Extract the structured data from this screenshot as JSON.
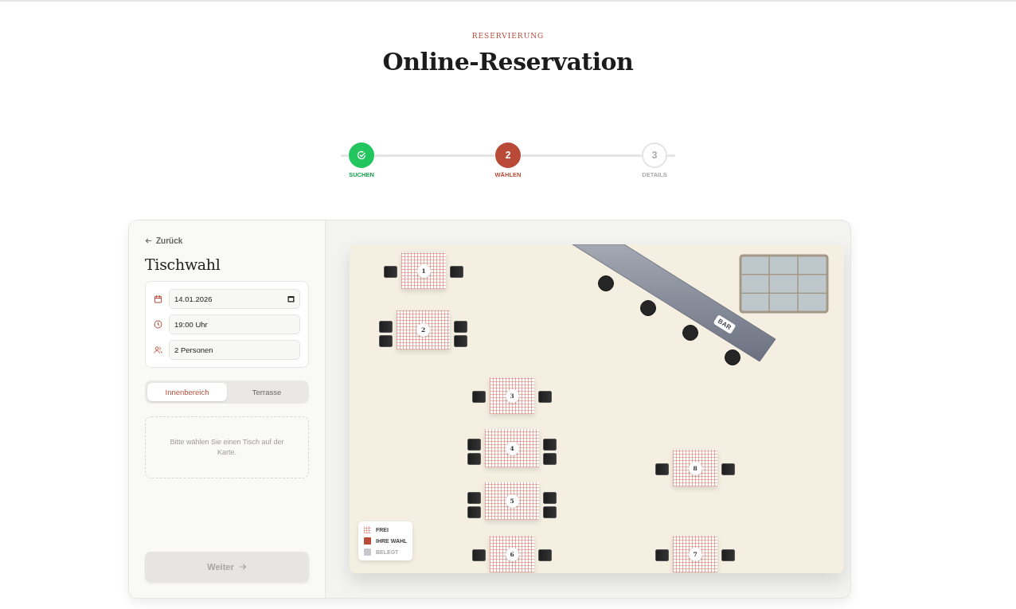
{
  "header": {
    "eyebrow": "RESERVIERUNG",
    "title": "Online-Reservation"
  },
  "steps": [
    {
      "label": "SUCHEN",
      "completed": true,
      "selected": false
    },
    {
      "label": "WÄHLEN",
      "number": "2",
      "completed": false,
      "selected": true
    },
    {
      "label": "DETAILS",
      "number": "3",
      "completed": false,
      "selected": false
    }
  ],
  "sidebar": {
    "back": "Zurück",
    "title": "Tischwahl",
    "fields": [
      {
        "kind": "date",
        "value": "14.01.2026"
      },
      {
        "kind": "time",
        "value": "19:00 Uhr"
      },
      {
        "kind": "guests",
        "value": "2 Personen"
      }
    ],
    "areas": [
      {
        "label": "Innenbereich",
        "selected": true
      },
      {
        "label": "Terrasse",
        "selected": false
      }
    ],
    "hint": "Bitte wählen Sie einen Tisch auf der Karte.",
    "next_button": {
      "label": "Weiter",
      "disabled": true
    }
  },
  "floor_plan": {
    "bar_label": "BAR",
    "tables": [
      {
        "number": "1",
        "selected": false,
        "occupied": false
      },
      {
        "number": "2",
        "selected": false,
        "occupied": false
      },
      {
        "number": "3",
        "selected": false,
        "occupied": false
      },
      {
        "number": "4",
        "selected": false,
        "occupied": false
      },
      {
        "number": "5",
        "selected": false,
        "occupied": false
      },
      {
        "number": "6",
        "selected": false,
        "occupied": false
      },
      {
        "number": "8",
        "selected": false,
        "occupied": false
      },
      {
        "number": "7",
        "selected": false,
        "occupied": false
      }
    ],
    "legend": [
      {
        "label": "FREI",
        "kind": "free"
      },
      {
        "label": "IHRE WAHL",
        "kind": "selected"
      },
      {
        "label": "BELEGT",
        "kind": "occupied"
      }
    ]
  }
}
